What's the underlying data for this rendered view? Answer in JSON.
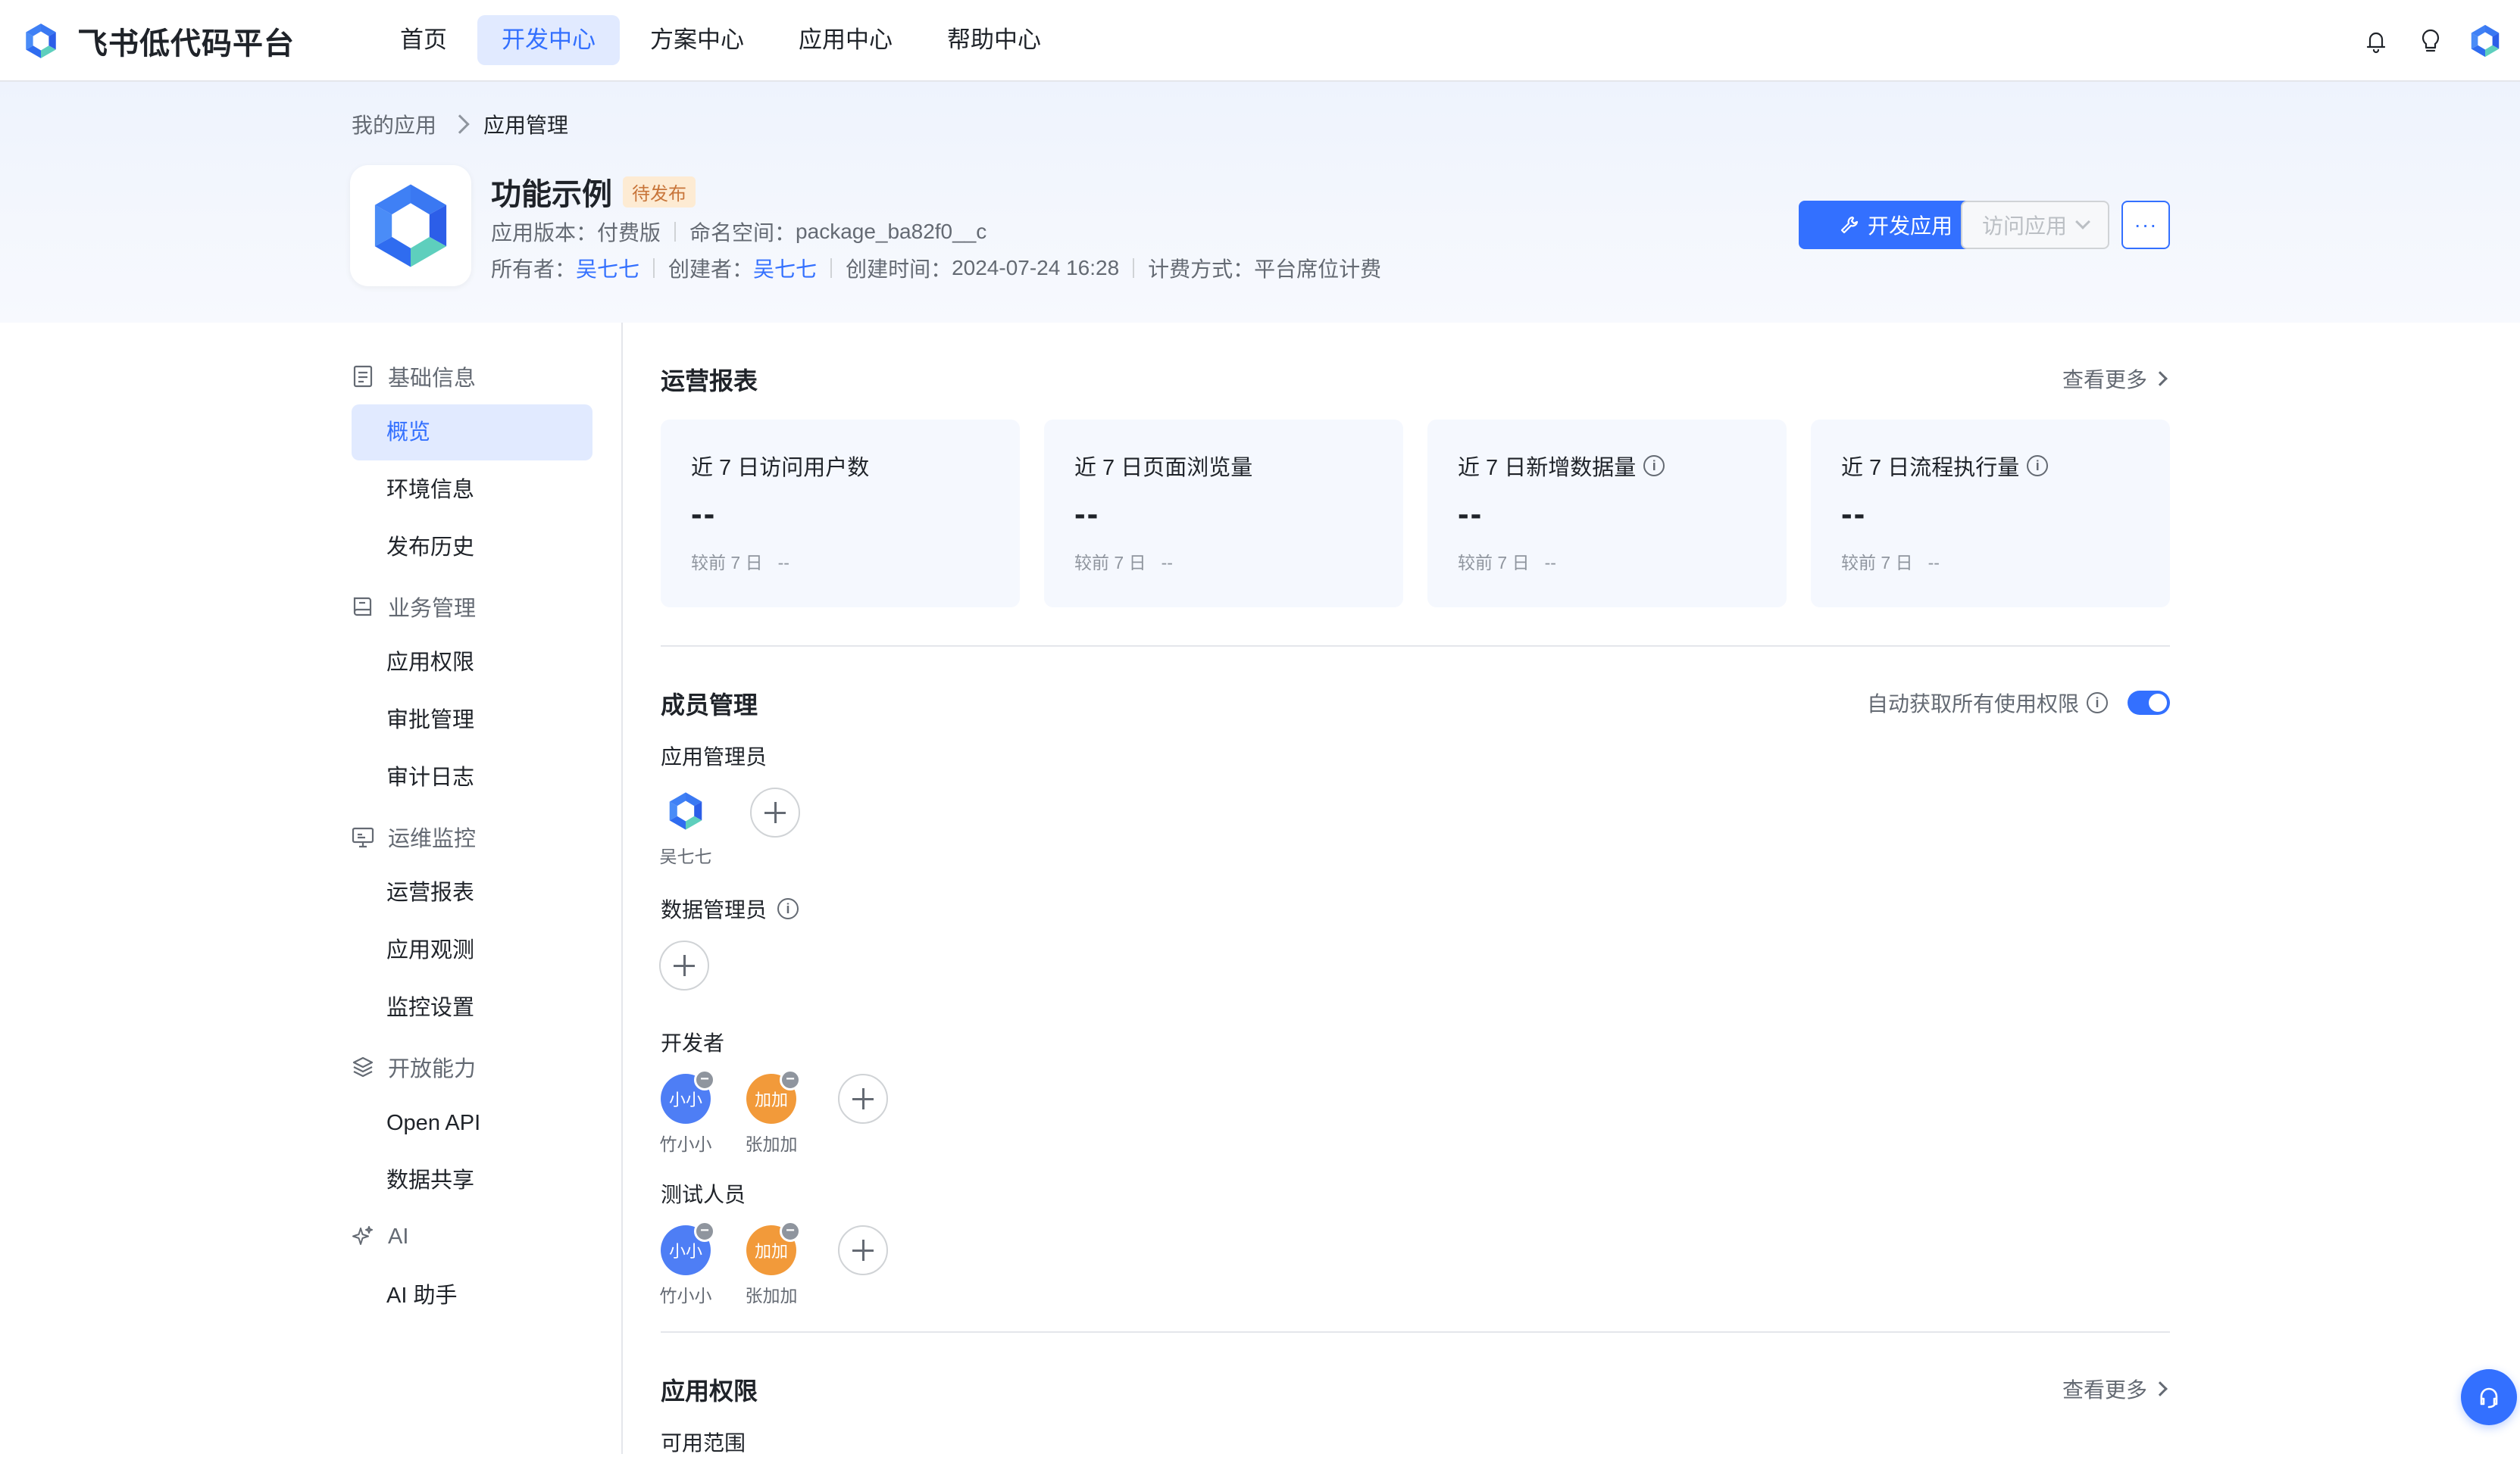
{
  "brand": {
    "name": "飞书低代码平台",
    "icon": "feishu-logo-icon"
  },
  "nav": {
    "items": [
      {
        "label": "首页",
        "active": false
      },
      {
        "label": "开发中心",
        "active": true
      },
      {
        "label": "方案中心",
        "active": false
      },
      {
        "label": "应用中心",
        "active": false
      },
      {
        "label": "帮助中心",
        "active": false
      }
    ],
    "icons": [
      "bell-icon",
      "lightbulb-icon",
      "user-avatar-logo"
    ]
  },
  "breadcrumb": {
    "parent": "我的应用",
    "current": "应用管理"
  },
  "app": {
    "title": "功能示例",
    "status": "待发布",
    "version_label": "应用版本：",
    "version_value": "付费版",
    "namespace_label": "命名空间：",
    "namespace_value": "package_ba82f0__c",
    "owner_label": "所有者：",
    "owner_value": "吴七七",
    "creator_label": "创建者：",
    "creator_value": "吴七七",
    "created_label": "创建时间：",
    "created_value": "2024-07-24 16:28",
    "billing_label": "计费方式：",
    "billing_value": "平台席位计费"
  },
  "actions": {
    "develop": "开发应用",
    "visit": "访问应用",
    "more": "···"
  },
  "sidebar": {
    "groups": [
      {
        "label": "基础信息",
        "icon": "document-icon",
        "items": [
          "概览",
          "环境信息",
          "发布历史"
        ]
      },
      {
        "label": "业务管理",
        "icon": "book-icon",
        "items": [
          "应用权限",
          "审批管理",
          "审计日志"
        ]
      },
      {
        "label": "运维监控",
        "icon": "monitor-icon",
        "items": [
          "运营报表",
          "应用观测",
          "监控设置"
        ]
      },
      {
        "label": "开放能力",
        "icon": "layers-icon",
        "items": [
          "Open API",
          "数据共享"
        ]
      },
      {
        "label": "AI",
        "icon": "sparkle-icon",
        "items": [
          "AI 助手"
        ]
      }
    ],
    "active": "概览"
  },
  "report": {
    "title": "运营报表",
    "see_more": "查看更多",
    "cards": [
      {
        "label": "近 7 日访问用户数",
        "value": "--",
        "compare_label": "较前 7 日",
        "compare_value": "--",
        "info": false
      },
      {
        "label": "近 7 日页面浏览量",
        "value": "--",
        "compare_label": "较前 7 日",
        "compare_value": "--",
        "info": false
      },
      {
        "label": "近 7 日新增数据量",
        "value": "--",
        "compare_label": "较前 7 日",
        "compare_value": "--",
        "info": true
      },
      {
        "label": "近 7 日流程执行量",
        "value": "--",
        "compare_label": "较前 7 日",
        "compare_value": "--",
        "info": true
      }
    ]
  },
  "members": {
    "title": "成员管理",
    "auto_permission_label": "自动获取所有使用权限",
    "auto_permission_enabled": true,
    "app_admin_label": "应用管理员",
    "app_admins": [
      {
        "name": "吴七七"
      }
    ],
    "data_admin_label": "数据管理员",
    "developer_label": "开发者",
    "developers": [
      {
        "avatar_text": "小小",
        "name": "竹小小",
        "color": "#4e7ef5"
      },
      {
        "avatar_text": "加加",
        "name": "张加加",
        "color": "#f29a3a"
      }
    ],
    "tester_label": "测试人员",
    "testers": [
      {
        "avatar_text": "小小",
        "name": "竹小小",
        "color": "#4e7ef5"
      },
      {
        "avatar_text": "加加",
        "name": "张加加",
        "color": "#f29a3a"
      }
    ]
  },
  "permissions": {
    "title": "应用权限",
    "see_more": "查看更多",
    "scope_label": "可用范围"
  },
  "colors": {
    "primary": "#3370ff",
    "badge_text": "#c8753a",
    "badge_bg": "#fdebd3",
    "card_bg": "#f5f8fe"
  }
}
